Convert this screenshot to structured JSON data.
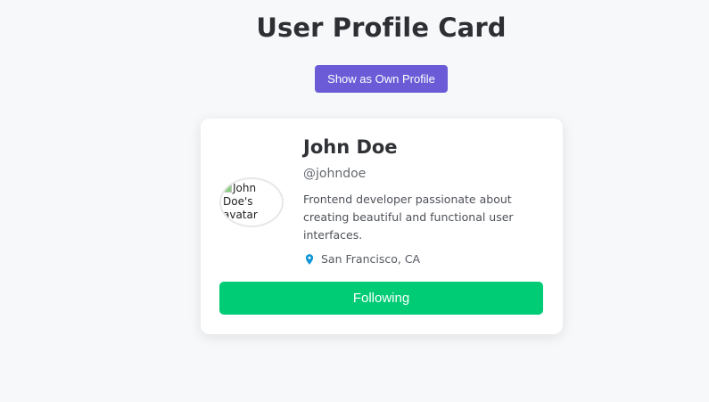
{
  "page": {
    "title": "User Profile Card"
  },
  "controls": {
    "own_profile_button": "Show as Own Profile"
  },
  "profile": {
    "avatar_alt": "John Doe's avatar",
    "name": "John Doe",
    "handle": "@johndoe",
    "bio": "Frontend developer passionate about creating beautiful and functional user interfaces.",
    "location": "San Francisco, CA",
    "follow_button": "Following"
  },
  "icons": {
    "location": "map-pin-icon",
    "avatar_placeholder": "broken-image-icon"
  },
  "colors": {
    "background": "#f7f8fa",
    "toggle_button": "#6b5bd6",
    "follow_button": "#00cc75",
    "location_pin": "#0d95d6"
  }
}
